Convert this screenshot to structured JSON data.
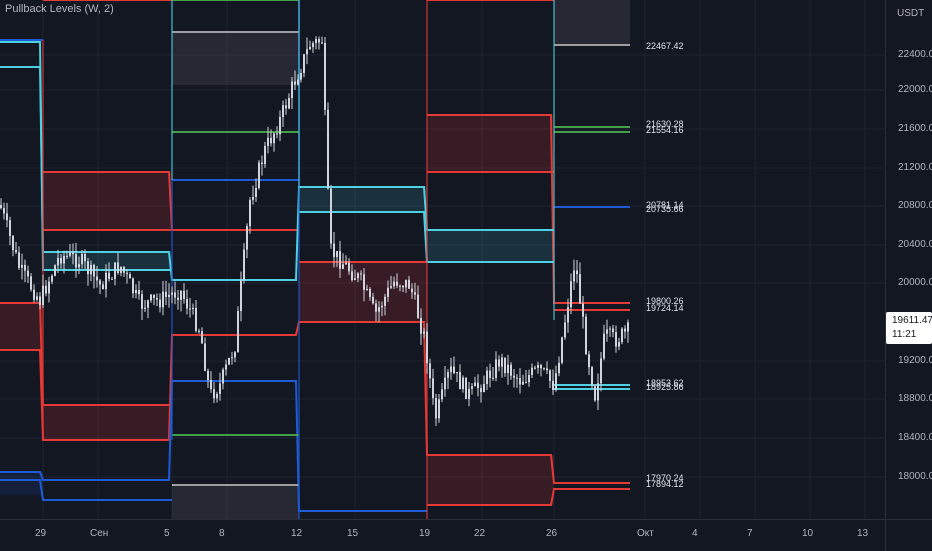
{
  "indicator": {
    "label": "Pullback Levels (W, 2)"
  },
  "price_axis": {
    "currency": "USDT",
    "ticks": [
      "22400.00",
      "22000.00",
      "21600.00",
      "21200.00",
      "20800.00",
      "20400.00",
      "20000.00",
      "19200.00",
      "18800.00",
      "18400.00",
      "18000.00"
    ],
    "last_price": "19611.47",
    "countdown": "11:21"
  },
  "time_axis": {
    "ticks": [
      "29",
      "Сен",
      "5",
      "8",
      "12",
      "15",
      "19",
      "22",
      "26",
      "Окт",
      "4",
      "7",
      "10",
      "13"
    ]
  },
  "level_labels": [
    "22467.42",
    "21630.28",
    "21554.16",
    "20781.14",
    "20735.66",
    "19800.26",
    "19724.14",
    "18953.62",
    "18925.86",
    "17970.24",
    "17894.12"
  ],
  "colors": {
    "background": "#131722",
    "red_level": "#e53935",
    "cyan_level": "#4dd0e1",
    "blue_level": "#1e5bd6",
    "green_level": "#43a047",
    "gray_level": "#9e9e9e",
    "candle": "#d1d4dc"
  }
}
